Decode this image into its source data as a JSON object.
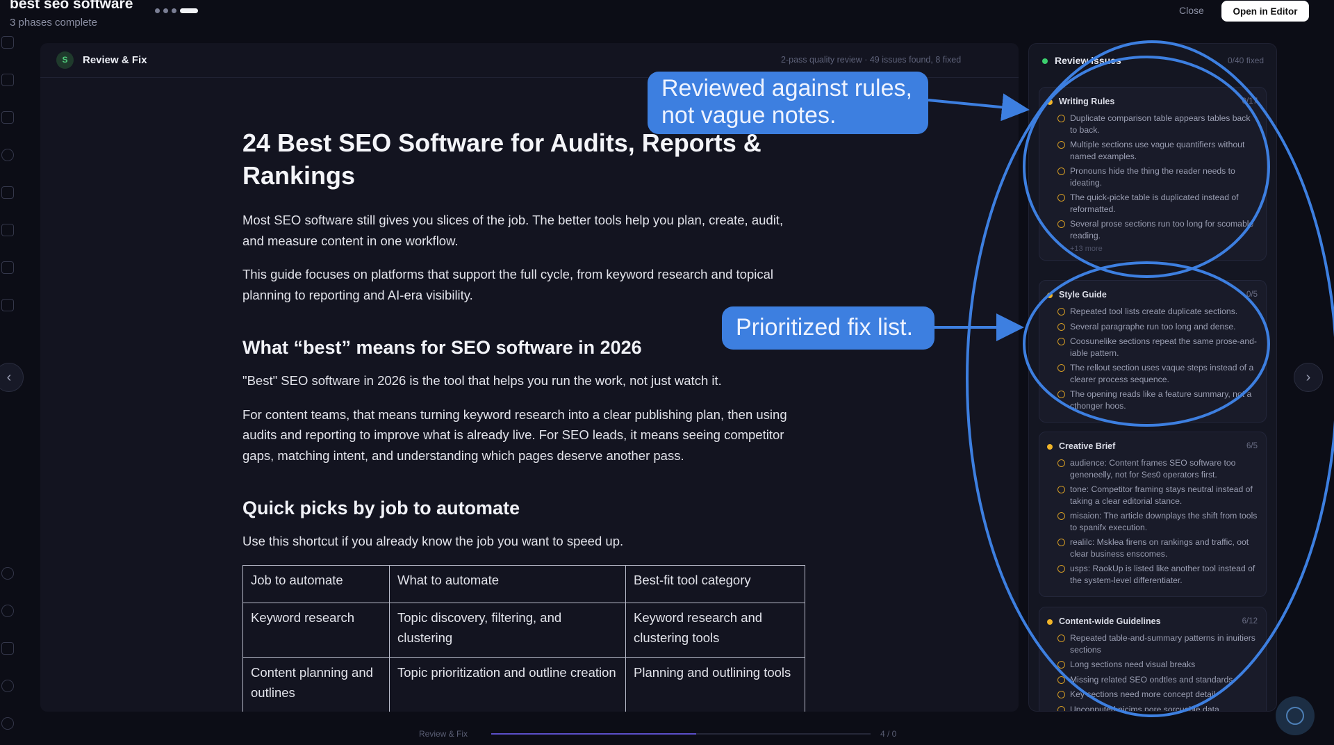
{
  "topbar": {
    "title": "best seo software",
    "subtitle": "3 phases complete",
    "close_label": "Close",
    "open_editor_label": "Open in Editor"
  },
  "document": {
    "header_title": "Review & Fix",
    "header_badge": "S",
    "header_meta": "2-pass quality review · 49 issues found, 8 fixed",
    "h1": "24 Best SEO Software for Audits, Reports & Rankings",
    "intro_1": "Most SEO software still gives you slices of the job. The better tools help you plan, create, audit, and measure content in one workflow.",
    "intro_2": "This guide focuses on platforms that support the full cycle, from keyword research and topical planning to reporting and AI-era visibility.",
    "h2_best": "What “best” means for SEO software in 2026",
    "best_1": "\"Best\" SEO software in 2026 is the tool that helps you run the work, not just watch it.",
    "best_2": "For content teams, that means turning keyword research into a clear publishing plan, then using audits and reporting to improve what is already live. For SEO leads, it means seeing competitor gaps, matching intent, and understanding which pages deserve another pass.",
    "h2_picks": "Quick picks by job to automate",
    "picks_intro": "Use this shortcut if you already know the job you want to speed up.",
    "table": {
      "headers": [
        "Job to automate",
        "What to automate",
        "Best-fit tool category"
      ],
      "rows": [
        [
          "Keyword research",
          "Topic discovery, filtering, and clustering",
          "Keyword research and clustering tools"
        ],
        [
          "Content planning and outlines",
          "Topic prioritization and outline creation",
          "Planning and outlining tools"
        ]
      ]
    }
  },
  "review": {
    "title": "Review issues",
    "count": "0/40 fixed",
    "groups": [
      {
        "title": "Writing Rules",
        "count": "0/17",
        "issues": [
          "Duplicate comparison table appears tables back to back.",
          "Multiple sections use vague quantifiers without named examples.",
          "Pronouns hide the thing the reader needs to ideating.",
          "The quick-picke table is duplicated instead of reformatted.",
          "Several prose sections run too long for scomable reading."
        ],
        "more": "+13 more"
      },
      {
        "title": "Style Guide",
        "count": "0/5",
        "issues": [
          "Repeated tool lists create duplicate sections.",
          "Several paragraphe run too long and dense.",
          "Coosunelike sections repeat the same prose-and-iable pattern.",
          "The rellout section uses vaque steps instead of a clearer process sequence.",
          "The opening reads like a feature summary, not a cthonger hoos."
        ]
      },
      {
        "title": "Creative Brief",
        "count": "6/5",
        "issues": [
          "audience: Content frames SEO software too geneneelly, not for Ses0 operators first.",
          "tone: Competitor framing stays neutral instead of taking a clear editorial stance.",
          "misaion: The article downplays the shift from tools to spanifx execution.",
          "realilc: Msklea firens on rankings and traffic, oot clear business enscomes.",
          "usps: RaokUp is listed like another tool instead of the system-level differentiater."
        ]
      },
      {
        "title": "Content-wide Guidelines",
        "count": "6/12",
        "issues": [
          "Repeated table-and-summary patterns in inuitiers sections",
          "Long sections need visual breaks",
          "Missing related SEO ondtles and standards",
          "Key sections need more concept detail",
          "Unconnuted nicims nore sorcuable data"
        ]
      }
    ]
  },
  "footer": {
    "label": "Review & Fix",
    "count": "4 / 0",
    "progress": 0.54
  },
  "annotations": {
    "callout_rules": "Reviewed against rules, not vague notes.",
    "callout_fix": "Prioritized fix list.",
    "color": "#3d7fe0"
  }
}
